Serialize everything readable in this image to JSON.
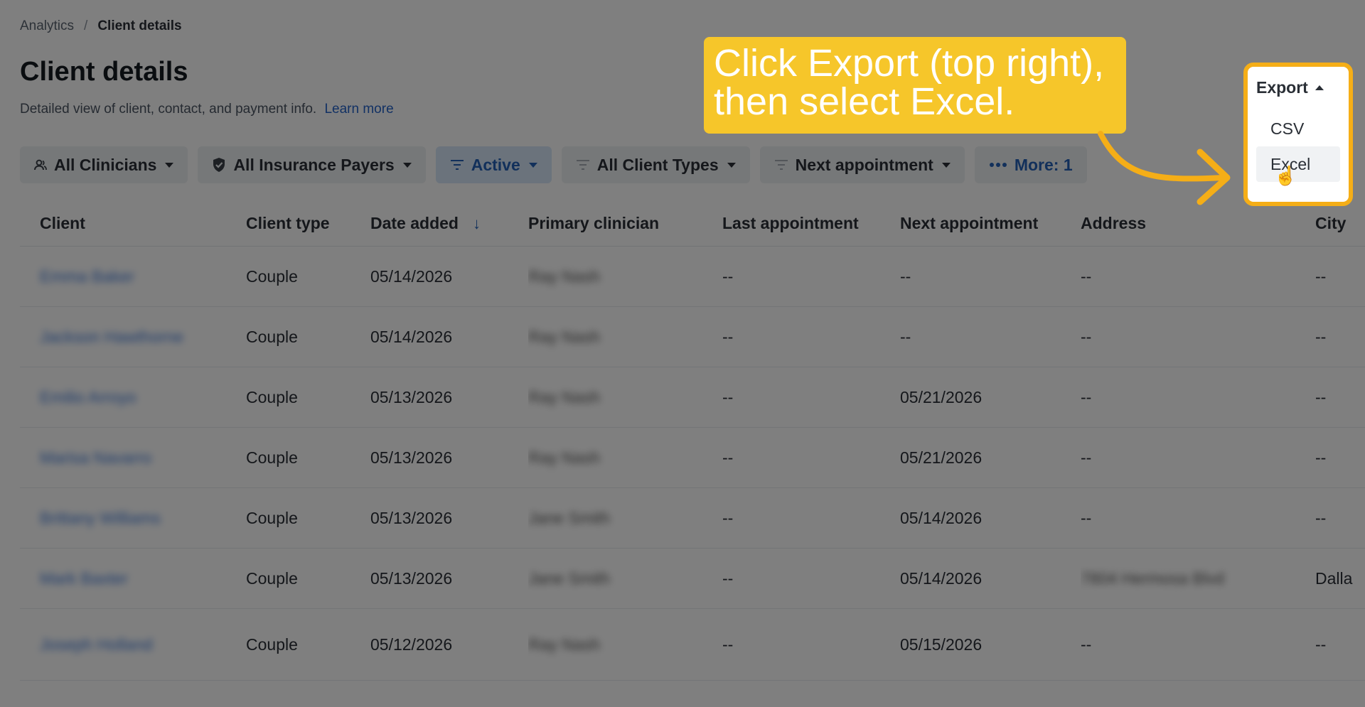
{
  "breadcrumb": {
    "root": "Analytics",
    "separator": "/",
    "current": "Client details"
  },
  "page": {
    "title": "Client details",
    "subtitle": "Detailed view of client, contact, and payment info.",
    "learn_more": "Learn more"
  },
  "filters": [
    {
      "label": "All Clinicians",
      "icon": "clinician-icon"
    },
    {
      "label": "All Insurance Payers",
      "icon": "shield-icon"
    },
    {
      "label": "Active",
      "icon": "filter-icon"
    },
    {
      "label": "All Client Types",
      "icon": "filter-icon"
    },
    {
      "label": "Next appointment",
      "icon": "filter-icon"
    },
    {
      "label": "More: 1",
      "icon": "more-dots-icon"
    }
  ],
  "table": {
    "columns": [
      "Client",
      "Client type",
      "Date added",
      "Primary clinician",
      "Last appointment",
      "Next appointment",
      "Address",
      "City"
    ],
    "rows": [
      {
        "client": "Emma Baker",
        "type": "Couple",
        "date_added": "05/14/2026",
        "clinician": "Ray Nash",
        "last": "--",
        "next": "--",
        "address": "--",
        "city": "--"
      },
      {
        "client": "Jackson Hawthorne",
        "type": "Couple",
        "date_added": "05/14/2026",
        "clinician": "Ray Nash",
        "last": "--",
        "next": "--",
        "address": "--",
        "city": "--"
      },
      {
        "client": "Emilio Arroyo",
        "type": "Couple",
        "date_added": "05/13/2026",
        "clinician": "Ray Nash",
        "last": "--",
        "next": "05/21/2026",
        "address": "--",
        "city": "--"
      },
      {
        "client": "Marisa Navarro",
        "type": "Couple",
        "date_added": "05/13/2026",
        "clinician": "Ray Nash",
        "last": "--",
        "next": "05/21/2026",
        "address": "--",
        "city": "--"
      },
      {
        "client": "Brittany Williams",
        "type": "Couple",
        "date_added": "05/13/2026",
        "clinician": "Jane Smith",
        "last": "--",
        "next": "05/14/2026",
        "address": "--",
        "city": "--"
      },
      {
        "client": "Mark Baxter",
        "type": "Couple",
        "date_added": "05/13/2026",
        "clinician": "Jane Smith",
        "last": "--",
        "next": "05/14/2026",
        "address": "7804 Hermosa Blvd",
        "city": "Dalla"
      },
      {
        "client": "Joseph Holland",
        "type": "Couple",
        "date_added": "05/12/2026",
        "clinician": "Ray Nash",
        "last": "--",
        "next": "05/15/2026",
        "address": "--",
        "city": "--"
      }
    ]
  },
  "export": {
    "button_label": "Export",
    "menu": [
      "CSV",
      "Excel"
    ]
  },
  "callout": {
    "line1": "Click Export (top right),",
    "line2": "then select Excel."
  },
  "colors": {
    "callout_bg": "#f6c62a",
    "highlight_border": "#f5ae17",
    "link": "#2563c9"
  }
}
